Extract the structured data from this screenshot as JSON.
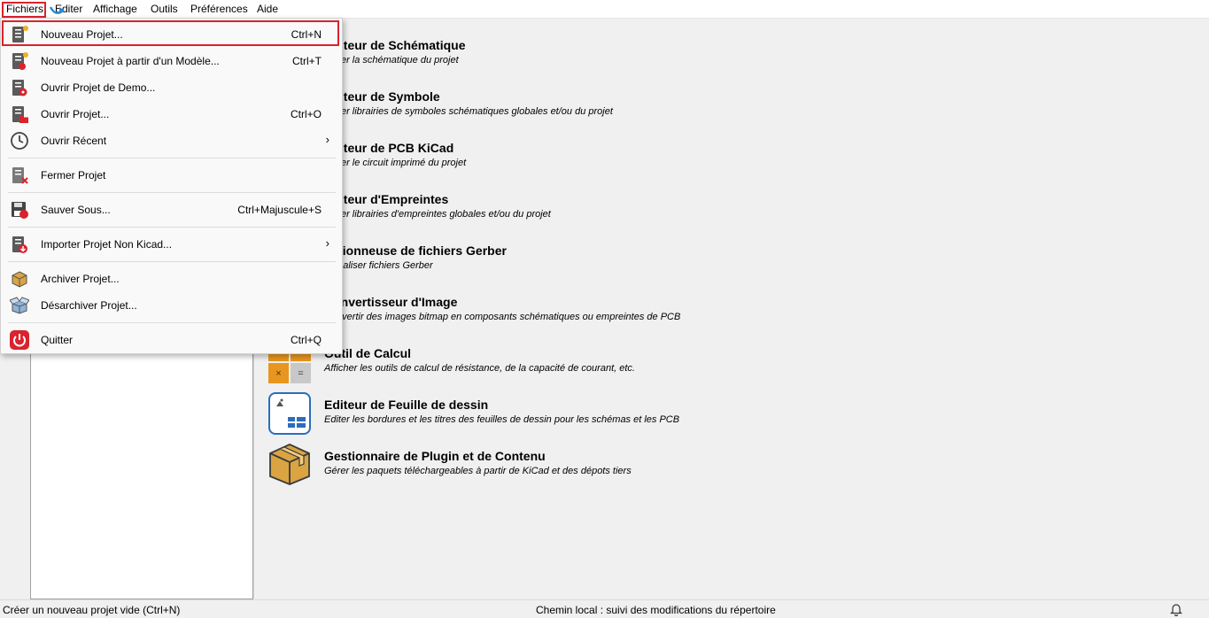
{
  "menubar": [
    "Fichiers",
    "Editer",
    "Affichage",
    "Outils",
    "Préférences",
    "Aide"
  ],
  "file_menu": {
    "items": [
      {
        "label": "Nouveau Projet...",
        "shortcut": "Ctrl+N",
        "icon": "new-project-icon"
      },
      {
        "label": "Nouveau Projet à partir d'un Modèle...",
        "shortcut": "Ctrl+T",
        "icon": "new-from-template-icon"
      },
      {
        "label": "Ouvrir Projet de Demo...",
        "shortcut": "",
        "icon": "open-demo-icon"
      },
      {
        "label": "Ouvrir Projet...",
        "shortcut": "Ctrl+O",
        "icon": "open-project-icon"
      },
      {
        "label": "Ouvrir Récent",
        "shortcut": "",
        "icon": "clock-icon",
        "submenu": true
      },
      {
        "label": "Fermer Projet",
        "shortcut": "",
        "icon": "close-project-icon"
      },
      {
        "label": "Sauver Sous...",
        "shortcut": "Ctrl+Majuscule+S",
        "icon": "save-as-icon"
      },
      {
        "label": "Importer Projet Non Kicad...",
        "shortcut": "",
        "icon": "import-icon",
        "submenu": true
      },
      {
        "label": "Archiver Projet...",
        "shortcut": "",
        "icon": "archive-icon"
      },
      {
        "label": "Désarchiver Projet...",
        "shortcut": "",
        "icon": "unarchive-icon"
      },
      {
        "label": "Quitter",
        "shortcut": "Ctrl+Q",
        "icon": "power-icon"
      }
    ],
    "submenu_arrow": "›"
  },
  "tools": [
    {
      "title": "Editeur de Schématique",
      "desc": "Editer la schématique du projet"
    },
    {
      "title": "Editeur de Symbole",
      "desc": "Editer librairies de symboles schématiques globales et/ou du projet"
    },
    {
      "title": "Editeur de PCB KiCad",
      "desc": "Editer le circuit imprimé du projet"
    },
    {
      "title": "Editeur d'Empreintes",
      "desc": "Editer librairies d'empreintes globales et/ou du projet"
    },
    {
      "title": "Visionneuse de fichiers Gerber",
      "desc": "Visualiser fichiers Gerber"
    },
    {
      "title": "Convertisseur d'Image",
      "desc": "Convertir des images bitmap en composants schématiques ou empreintes de PCB"
    },
    {
      "title": "Outil de Calcul",
      "desc": "Afficher les outils de calcul de résistance, de la capacité de courant, etc."
    },
    {
      "title": "Editeur de Feuille de dessin",
      "desc": "Editer les bordures et les titres des feuilles de dessin pour les schémas et les PCB"
    },
    {
      "title": "Gestionnaire de Plugin et de Contenu",
      "desc": "Gérer les paquets téléchargeables à partir de KiCad et des dépots tiers"
    }
  ],
  "status": {
    "left": "Créer un nouveau projet vide  (Ctrl+N)",
    "center": "Chemin local : suivi des modifications du répertoire"
  },
  "colors": {
    "highlight_box": "#d9232e",
    "accent_blue": "#2a6ebb",
    "calc_orange": "#e8961e",
    "box_tan": "#d9a441"
  }
}
